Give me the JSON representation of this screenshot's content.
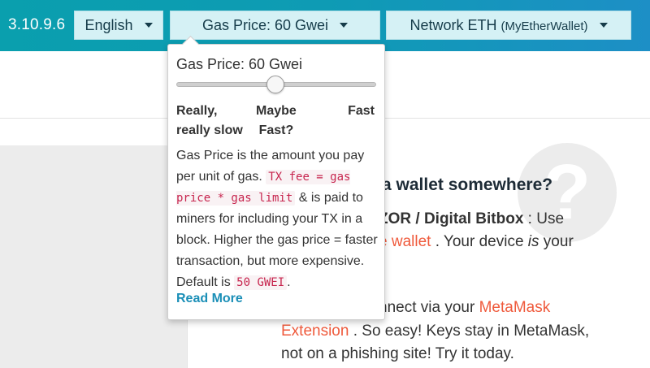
{
  "header": {
    "version": "3.10.9.6",
    "language_label": "English",
    "gas_button_label": "Gas Price: 60 Gwei",
    "network_label": "Network ETH",
    "network_provider": "(MyEtherWallet)"
  },
  "colors": {
    "header_start": "#0a9fae",
    "header_end": "#1d8fc6",
    "button_bg": "#d5f1f5",
    "link": "#ef5a3c",
    "read_more": "#1b8fb7",
    "code": "#c7254e"
  },
  "gas_popover": {
    "title": "Gas Price: 60 Gwei",
    "slider_value_gwei": 60,
    "labels": {
      "slow_line1": "Really,",
      "slow_line2": "really slow",
      "maybe_line1": "Maybe",
      "maybe_line2": "Fast?",
      "fast": "Fast"
    },
    "desc_part1": "Gas Price is the amount you pay per unit of gas.",
    "desc_code1": "TX fee = gas price * gas limit",
    "desc_part2": "& is paid to miners for including your TX in a block. Higher the gas price = faster transaction, but more expensive. Default is",
    "desc_code2": "50 GWEI",
    "desc_part3": ".",
    "read_more": "Read More"
  },
  "main": {
    "heading_partial": "a wallet somewhere?",
    "line1_bold": "ZOR / Digital Bitbox",
    "line1_rest": " : Use",
    "line2_link": "e wallet",
    "line2_rest_a": " . Your device ",
    "line2_em": "is",
    "line2_rest_b": " your",
    "line3_text": "nnect via your ",
    "line3_link": "MetaMask",
    "line4_link": "Extension",
    "line4_rest": " . So easy! Keys stay in MetaMask,",
    "line5": "not on a phishing site! Try it today."
  }
}
